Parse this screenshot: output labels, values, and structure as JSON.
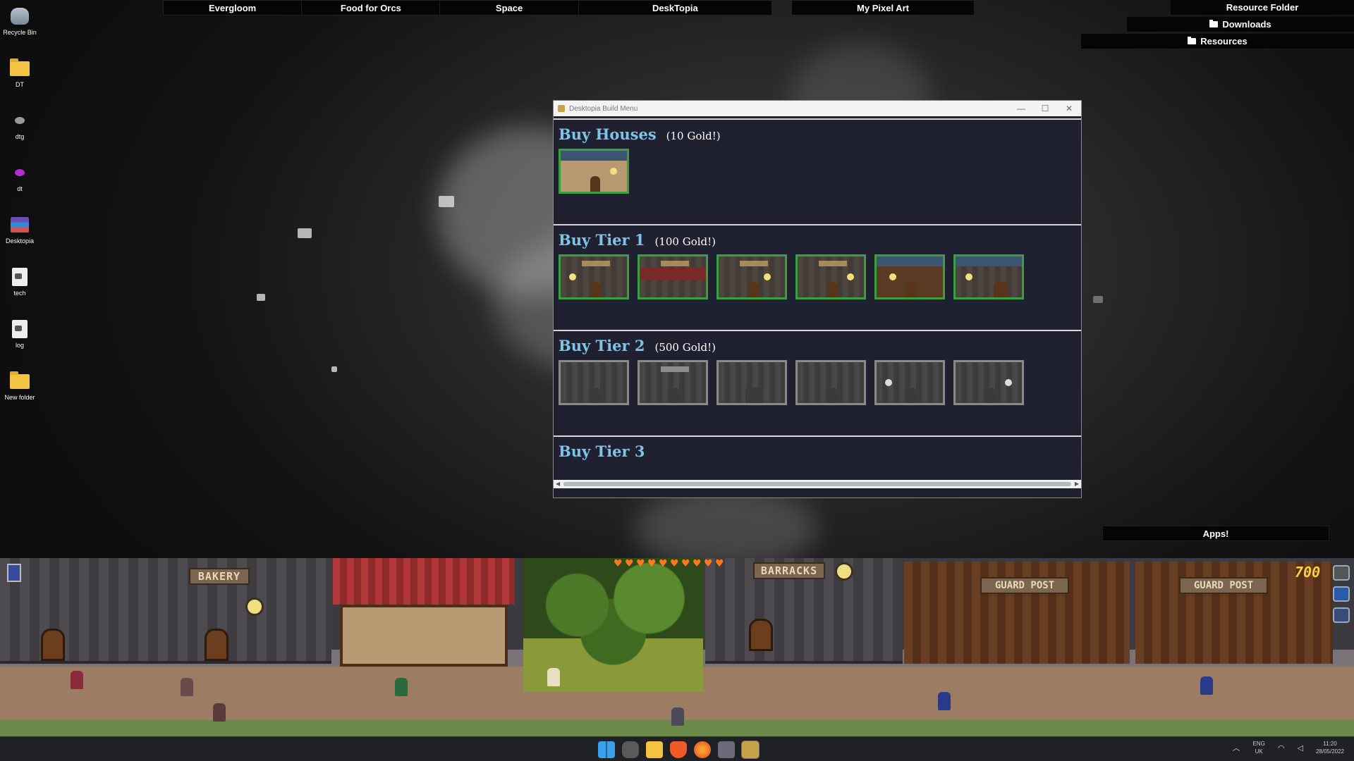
{
  "desktop_icons": [
    {
      "label": "Recycle Bin",
      "icon": "recycle-bin-icon"
    },
    {
      "label": "DT",
      "icon": "folder-icon"
    },
    {
      "label": "dtg",
      "icon": "app-icon"
    },
    {
      "label": "dt",
      "icon": "app-icon"
    },
    {
      "label": "Desktopia",
      "icon": "archive-icon"
    },
    {
      "label": "tech",
      "icon": "file-icon"
    },
    {
      "label": "log",
      "icon": "file-icon"
    },
    {
      "label": "New folder",
      "icon": "folder-icon"
    }
  ],
  "top_bar_left": [
    "Evergloom",
    "Food for Orcs",
    "Space",
    "DeskTopia"
  ],
  "top_bar_mid": "My Pixel Art",
  "resources": {
    "resource_folder": "Resource Folder",
    "downloads": "Downloads",
    "resources": "Resources"
  },
  "window": {
    "title": "Desktopia Build Menu",
    "minimize": "—",
    "maximize": "☐",
    "close": "✕",
    "sections": [
      {
        "title": "Buy Houses",
        "price": "(10 Gold!)"
      },
      {
        "title": "Buy Tier 1",
        "price": "(100 Gold!)"
      },
      {
        "title": "Buy Tier 2",
        "price": "(500 Gold!)"
      },
      {
        "title": "Buy Tier 3",
        "price": ""
      }
    ]
  },
  "apps_button": "Apps!",
  "game": {
    "signs": [
      "BAKERY",
      "BARRACKS",
      "GUARD POST",
      "GUARD POST"
    ],
    "hearts": 10,
    "gold": "700"
  },
  "taskbar": {
    "lang_line1": "ENG",
    "lang_line2": "UK",
    "time": "11:20",
    "date": "28/05/2022"
  },
  "colors": {
    "section_title": "#7ec4e8",
    "tile_available_border": "#3a9f3f",
    "tile_locked_border": "#8a8a8a",
    "window_bg": "#1f2130"
  }
}
